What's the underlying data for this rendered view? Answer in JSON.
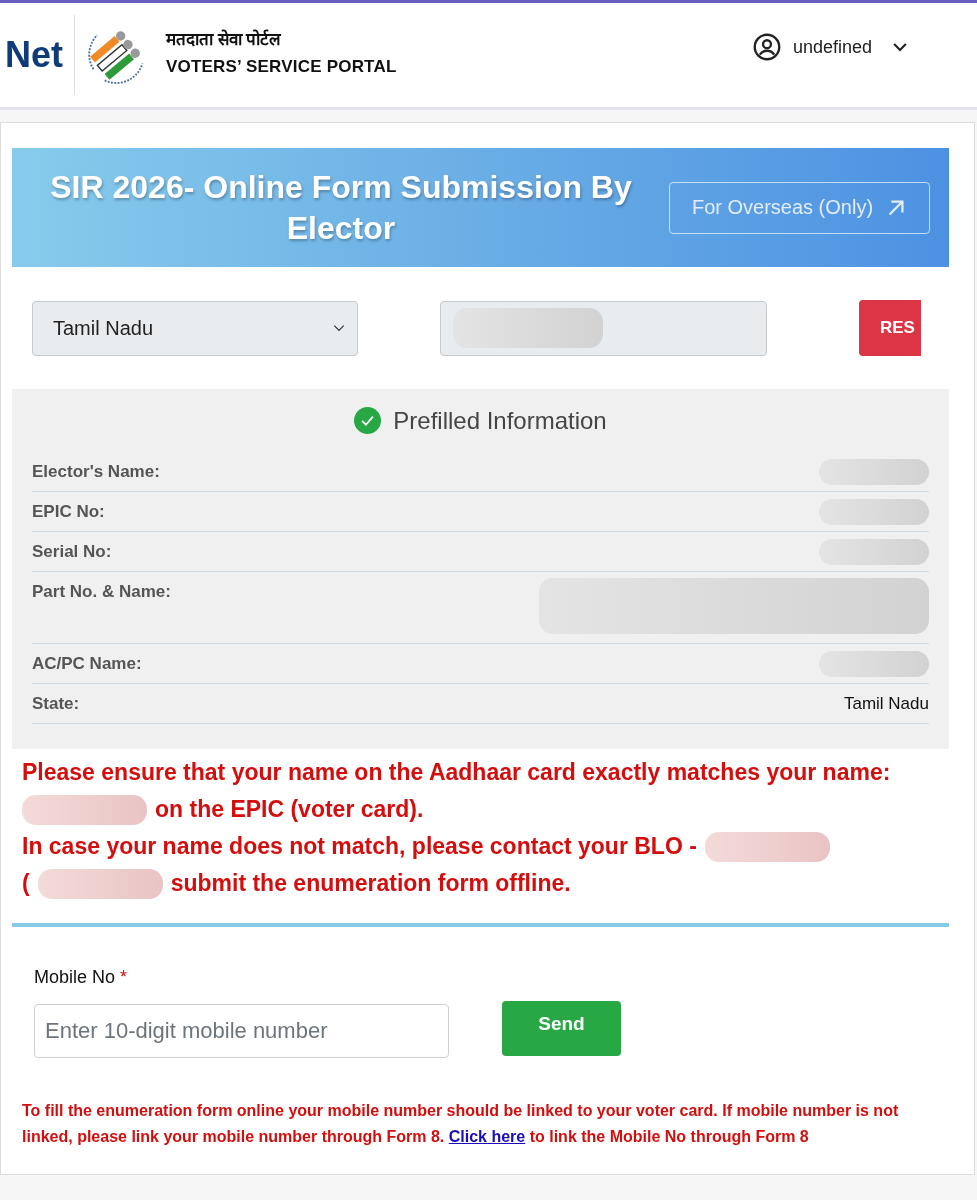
{
  "header": {
    "brand_text": "Net",
    "portal_title_hindi": "मतदाता सेवा पोर्टल",
    "portal_title": "VOTERS’ SERVICE PORTAL",
    "user_menu": {
      "label": "undefined"
    }
  },
  "banner": {
    "title": "SIR 2026- Online Form Submission By Elector",
    "overseas_button": "For Overseas (Only)"
  },
  "search": {
    "state_select": {
      "value": "Tamil Nadu"
    },
    "epic_field": {
      "redacted": true
    },
    "reset_button": "RES"
  },
  "prefilled": {
    "title": "Prefilled Information",
    "rows": [
      {
        "kind": "single",
        "label": "Elector's Name:",
        "redacted": true
      },
      {
        "kind": "single",
        "label": "EPIC No:",
        "redacted": true
      },
      {
        "kind": "single",
        "label": "Serial No:",
        "redacted": true
      },
      {
        "kind": "double",
        "label": "Part No. & Name:",
        "redacted": true
      },
      {
        "kind": "single",
        "label": "AC/PC Name:",
        "redacted": true
      },
      {
        "kind": "single",
        "label": "State:",
        "value": "Tamil Nadu",
        "redacted": false
      }
    ]
  },
  "notice": {
    "lines": [
      [
        {
          "kind": "text",
          "text": "Please ensure that your name on the Aadhaar card exactly matches your name:"
        }
      ],
      [
        {
          "kind": "redacted"
        },
        {
          "kind": "text",
          "text": "on the EPIC (voter card)."
        }
      ],
      [
        {
          "kind": "text",
          "text": "In case your name does not match, please contact your BLO -"
        },
        {
          "kind": "redacted"
        }
      ],
      [
        {
          "kind": "text",
          "text": "("
        },
        {
          "kind": "redacted"
        },
        {
          "kind": "text",
          "text": "submit the enumeration form offline."
        }
      ]
    ]
  },
  "mobile": {
    "label": "Mobile No",
    "required_mark": "*",
    "placeholder": "Enter 10-digit mobile number",
    "send_button": "Send"
  },
  "note": {
    "text_before": "To fill the enumeration form online your mobile number should be linked to your voter card. If mobile number is not linked, please link your mobile number through Form 8. ",
    "link": "Click here",
    "text_after": " to link the Mobile No through Form 8"
  }
}
